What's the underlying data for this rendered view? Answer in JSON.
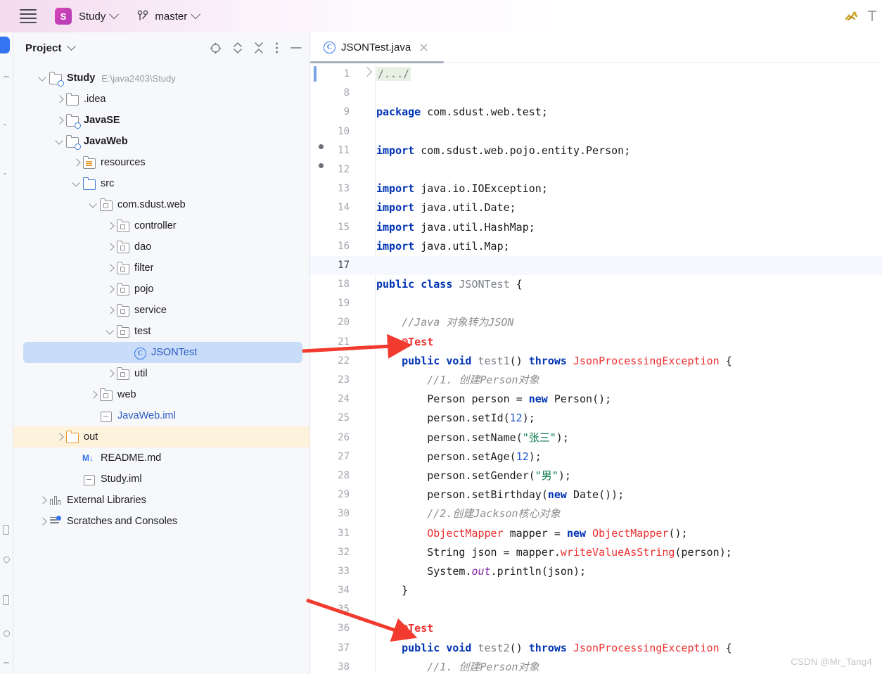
{
  "header": {
    "menu_icon": "hamburger-icon",
    "project_badge": "S",
    "project_name": "Study",
    "branch_icon": "git-branch-icon",
    "branch_name": "master",
    "right_icon": "run-config-icon"
  },
  "project_panel": {
    "title": "Project",
    "toolbar_icons": [
      {
        "name": "select-opened-file-icon",
        "label": "target"
      },
      {
        "name": "expand-collapse-icon",
        "label": "chevrons"
      },
      {
        "name": "collapse-all-icon",
        "label": "collapse"
      },
      {
        "name": "more-options-icon",
        "label": "kebab"
      },
      {
        "name": "hide-panel-icon",
        "label": "minimize"
      }
    ],
    "tree": [
      {
        "label": "Study",
        "detail": "E:\\java2403\\Study",
        "indent": 0,
        "arrow": "open",
        "icon": "module-folder-icon",
        "bold": true,
        "state": "normal"
      },
      {
        "label": ".idea",
        "detail": "",
        "indent": 1,
        "arrow": "closed",
        "icon": "folder-icon",
        "bold": false,
        "state": "normal"
      },
      {
        "label": "JavaSE",
        "detail": "",
        "indent": 1,
        "arrow": "closed",
        "icon": "module-folder-icon",
        "bold": true,
        "state": "normal"
      },
      {
        "label": "JavaWeb",
        "detail": "",
        "indent": 1,
        "arrow": "open",
        "icon": "module-folder-icon",
        "bold": true,
        "state": "normal"
      },
      {
        "label": "resources",
        "detail": "",
        "indent": 2,
        "arrow": "closed",
        "icon": "resources-folder-icon",
        "bold": false,
        "state": "normal"
      },
      {
        "label": "src",
        "detail": "",
        "indent": 2,
        "arrow": "open",
        "icon": "source-folder-icon",
        "bold": false,
        "state": "normal"
      },
      {
        "label": "com.sdust.web",
        "detail": "",
        "indent": 3,
        "arrow": "open",
        "icon": "package-icon",
        "bold": false,
        "state": "normal"
      },
      {
        "label": "controller",
        "detail": "",
        "indent": 4,
        "arrow": "closed",
        "icon": "package-icon",
        "bold": false,
        "state": "normal"
      },
      {
        "label": "dao",
        "detail": "",
        "indent": 4,
        "arrow": "closed",
        "icon": "package-icon",
        "bold": false,
        "state": "normal"
      },
      {
        "label": "filter",
        "detail": "",
        "indent": 4,
        "arrow": "closed",
        "icon": "package-icon",
        "bold": false,
        "state": "normal"
      },
      {
        "label": "pojo",
        "detail": "",
        "indent": 4,
        "arrow": "closed",
        "icon": "package-icon",
        "bold": false,
        "state": "normal"
      },
      {
        "label": "service",
        "detail": "",
        "indent": 4,
        "arrow": "closed",
        "icon": "package-icon",
        "bold": false,
        "state": "normal"
      },
      {
        "label": "test",
        "detail": "",
        "indent": 4,
        "arrow": "open",
        "icon": "package-icon",
        "bold": false,
        "state": "normal"
      },
      {
        "label": "JSONTest",
        "detail": "",
        "indent": 5,
        "arrow": "none",
        "icon": "java-class-icon",
        "bold": false,
        "state": "selected"
      },
      {
        "label": "util",
        "detail": "",
        "indent": 4,
        "arrow": "closed",
        "icon": "package-icon",
        "bold": false,
        "state": "normal"
      },
      {
        "label": "web",
        "detail": "",
        "indent": 3,
        "arrow": "closed",
        "icon": "package-icon",
        "bold": false,
        "state": "normal"
      },
      {
        "label": "JavaWeb.iml",
        "detail": "",
        "indent": 3,
        "arrow": "none",
        "icon": "iml-file-icon",
        "bold": false,
        "state": "link"
      },
      {
        "label": "out",
        "detail": "",
        "indent": 1,
        "arrow": "closed",
        "icon": "excluded-folder-icon",
        "bold": false,
        "state": "excluded"
      },
      {
        "label": "README.md",
        "detail": "",
        "indent": 2,
        "arrow": "none",
        "icon": "markdown-file-icon",
        "bold": false,
        "state": "normal"
      },
      {
        "label": "Study.iml",
        "detail": "",
        "indent": 2,
        "arrow": "none",
        "icon": "iml-file-icon",
        "bold": false,
        "state": "normal"
      },
      {
        "label": "External Libraries",
        "detail": "",
        "indent": 0,
        "arrow": "closed",
        "icon": "libraries-icon",
        "bold": false,
        "state": "normal"
      },
      {
        "label": "Scratches and Consoles",
        "detail": "",
        "indent": 0,
        "arrow": "closed",
        "icon": "scratches-icon",
        "bold": false,
        "state": "normal"
      }
    ]
  },
  "editor": {
    "tab": {
      "label": "JSONTest.java",
      "icon": "java-class-icon",
      "close_icon": "close-icon"
    },
    "current_line": 17,
    "lines": [
      {
        "n": "1",
        "folded": true,
        "text": "/.../"
      },
      {
        "n": "8",
        "text": ""
      },
      {
        "n": "9",
        "text": "package com.sdust.web.test;"
      },
      {
        "n": "10",
        "text": ""
      },
      {
        "n": "11",
        "text": "import com.sdust.web.pojo.entity.Person;"
      },
      {
        "n": "12",
        "text": ""
      },
      {
        "n": "13",
        "text": "import java.io.IOException;"
      },
      {
        "n": "14",
        "text": "import java.util.Date;"
      },
      {
        "n": "15",
        "text": "import java.util.HashMap;"
      },
      {
        "n": "16",
        "text": "import java.util.Map;"
      },
      {
        "n": "17",
        "text": ""
      },
      {
        "n": "18",
        "text": "public class JSONTest {"
      },
      {
        "n": "19",
        "text": ""
      },
      {
        "n": "20",
        "text": "    //Java 对象转为JSON"
      },
      {
        "n": "21",
        "text": "    @Test"
      },
      {
        "n": "22",
        "text": "    public void test1() throws JsonProcessingException {"
      },
      {
        "n": "23",
        "text": "        //1. 创建Person对象"
      },
      {
        "n": "24",
        "text": "        Person person = new Person();"
      },
      {
        "n": "25",
        "text": "        person.setId(12);"
      },
      {
        "n": "26",
        "text": "        person.setName(\"张三\");"
      },
      {
        "n": "27",
        "text": "        person.setAge(12);"
      },
      {
        "n": "28",
        "text": "        person.setGender(\"男\");"
      },
      {
        "n": "29",
        "text": "        person.setBirthday(new Date());"
      },
      {
        "n": "30",
        "text": "        //2.创建Jackson核心对象"
      },
      {
        "n": "31",
        "text": "        ObjectMapper mapper = new ObjectMapper();"
      },
      {
        "n": "32",
        "text": "        String json = mapper.writeValueAsString(person);"
      },
      {
        "n": "33",
        "text": "        System.out.println(json);"
      },
      {
        "n": "34",
        "text": "    }"
      },
      {
        "n": "35",
        "text": ""
      },
      {
        "n": "36",
        "text": "    @Test"
      },
      {
        "n": "37",
        "text": "    public void test2() throws JsonProcessingException {"
      },
      {
        "n": "38",
        "text": "        //1. 创建Person对象"
      }
    ]
  },
  "annotations": {
    "arrow_color": "#f23a2e",
    "arrows": [
      {
        "name": "arrow-to-test1-annotation",
        "target_line": "21"
      },
      {
        "name": "arrow-to-test2-annotation",
        "target_line": "36"
      }
    ]
  },
  "watermark": "CSDN @Mr_Tang4",
  "colors": {
    "accent": "#3574f0",
    "selection": "#c9dcf8",
    "excluded": "#fdf3dd",
    "error": "#ec2f2f",
    "keyword": "#0033b3",
    "string": "#087a4c",
    "comment": "#8c8c8c"
  }
}
